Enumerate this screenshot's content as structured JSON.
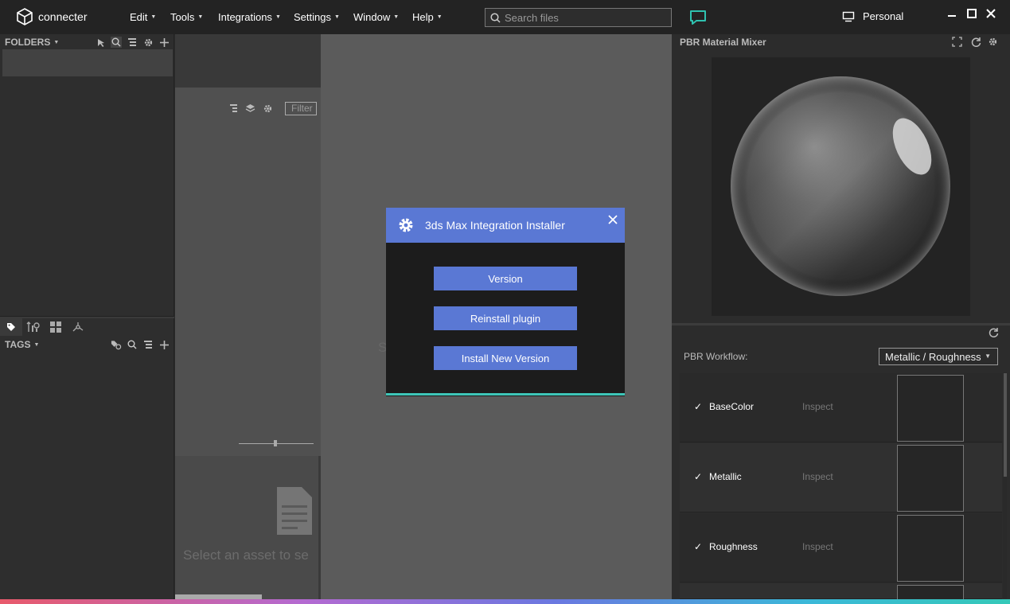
{
  "app": {
    "name": "connecter"
  },
  "menu": [
    {
      "label": "Edit"
    },
    {
      "label": "Tools"
    },
    {
      "label": "Integrations"
    },
    {
      "label": "Settings"
    },
    {
      "label": "Window"
    },
    {
      "label": "Help"
    }
  ],
  "search": {
    "placeholder": "Search files"
  },
  "workspace": {
    "label": "Personal"
  },
  "folders": {
    "header": "FOLDERS"
  },
  "tags": {
    "header": "TAGS"
  },
  "middle": {
    "filter_placeholder": "Filter",
    "empty_text": "Select an asset to se",
    "partial_char": "S"
  },
  "pbr": {
    "title": "PBR Material Mixer",
    "workflow_label": "PBR Workflow:",
    "workflow_value": "Metallic / Roughness",
    "rows": [
      {
        "checked": "✓",
        "name": "BaseColor",
        "action": "Inspect"
      },
      {
        "checked": "✓",
        "name": "Metallic",
        "action": "Inspect"
      },
      {
        "checked": "✓",
        "name": "Roughness",
        "action": "Inspect"
      }
    ]
  },
  "modal": {
    "title": "3ds Max Integration Installer",
    "buttons": [
      "Version",
      "Reinstall plugin",
      "Install New Version"
    ]
  },
  "colors": {
    "accent": "#5a78d4",
    "teal": "#3ec6b8",
    "chat": "#2fc2b0"
  }
}
